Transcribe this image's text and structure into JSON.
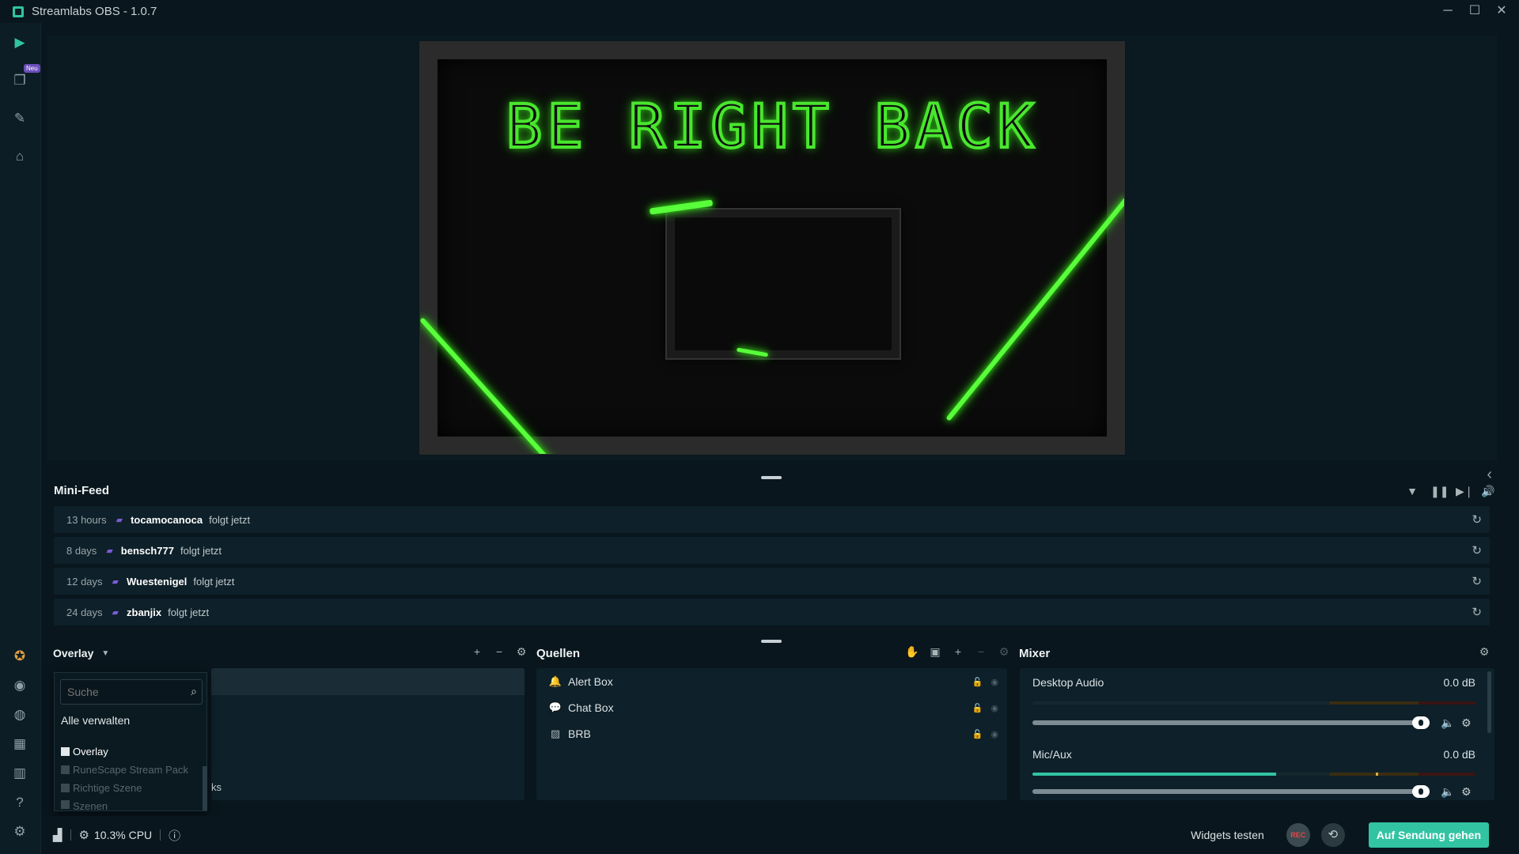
{
  "window": {
    "title": "Streamlabs OBS - 1.0.7",
    "controls": {
      "minimize": "─",
      "maximize": "☐",
      "close": "✕"
    }
  },
  "sidebar": {
    "new_badge": "Neu",
    "top_icons": [
      "studio-icon",
      "themes-icon",
      "editor-icon",
      "store-icon"
    ],
    "bottom_icons": [
      "prime-icon",
      "dashboard-icon",
      "chat-icon",
      "layout-icon",
      "columns-icon",
      "help-icon",
      "settings-icon"
    ]
  },
  "preview": {
    "scene_text": "BE RIGHT BACK",
    "accent": "#49e62e"
  },
  "minifeed": {
    "title": "Mini-Feed",
    "items": [
      {
        "time": "13 hours",
        "user": "tocamocanoca",
        "action": "folgt jetzt"
      },
      {
        "time": "8 days",
        "user": "bensch777",
        "action": "folgt jetzt"
      },
      {
        "time": "12 days",
        "user": "Wuestenigel",
        "action": "folgt jetzt"
      },
      {
        "time": "24 days",
        "user": "zbanjix",
        "action": "folgt jetzt"
      }
    ]
  },
  "scenes": {
    "collection_label": "Overlay",
    "fragment_text": "ks",
    "dropdown": {
      "search_placeholder": "Suche",
      "manage_all": "Alle verwalten",
      "collections": [
        "Overlay",
        "RuneScape Stream Pack",
        "Richtige Szene",
        "Szenen"
      ]
    }
  },
  "sources": {
    "title": "Quellen",
    "items": [
      {
        "icon": "bell-icon",
        "name": "Alert Box"
      },
      {
        "icon": "chat-icon",
        "name": "Chat Box"
      },
      {
        "icon": "image-icon",
        "name": "BRB"
      }
    ]
  },
  "mixer": {
    "title": "Mixer",
    "channels": [
      {
        "name": "Desktop Audio",
        "db": "0.0 dB",
        "level": 0,
        "volume": 1.0
      },
      {
        "name": "Mic/Aux",
        "db": "0.0 dB",
        "level": 0.55,
        "volume": 1.0
      }
    ]
  },
  "statusbar": {
    "cpu": "10.3% CPU",
    "widgets_test": "Widgets testen",
    "rec_label": "REC",
    "go_live": "Auf Sendung gehen"
  },
  "colors": {
    "accent": "#31c3a2",
    "background": "#09161d",
    "panel": "#0e2029",
    "twitch": "#7a5cd6"
  }
}
